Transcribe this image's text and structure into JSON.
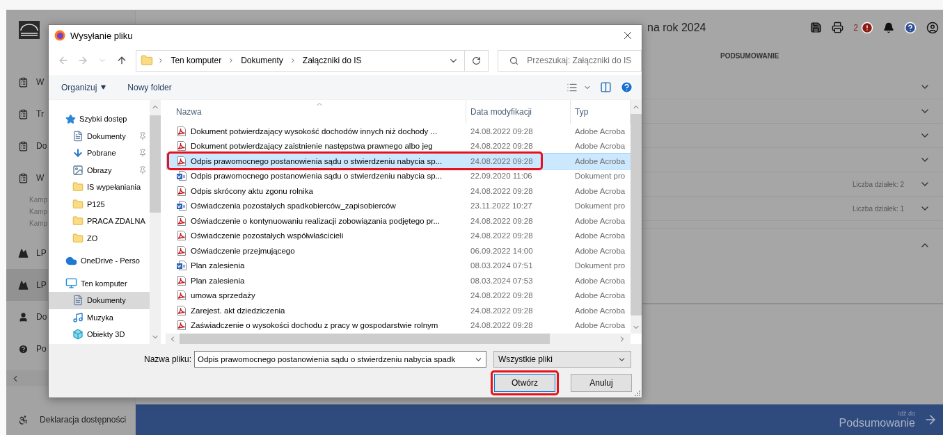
{
  "app": {
    "title": "na rok 2024",
    "alerts": "2",
    "tab": "PODSUMOWANIE",
    "sidebar": [
      {
        "kind": "clipboard",
        "label": "W",
        "selected": false
      },
      {
        "kind": "clipboard",
        "label": "Tr",
        "selected": false
      },
      {
        "kind": "clipboard",
        "label": "Do",
        "selected": false
      },
      {
        "kind": "clipboard",
        "label": "W",
        "selected": false
      },
      {
        "kind": "sub",
        "label": "Kamp",
        "selected": false
      },
      {
        "kind": "sub",
        "label": "Kamp",
        "selected": false
      },
      {
        "kind": "sub",
        "label": "Kamp",
        "selected": false
      },
      {
        "kind": "terrain",
        "label": "LP",
        "selected": false
      },
      {
        "kind": "terrain",
        "label": "LP",
        "selected": true
      },
      {
        "kind": "person",
        "label": "Do",
        "selected": false
      },
      {
        "kind": "help",
        "label": "Po",
        "selected": false
      }
    ],
    "accessibility": "Deklaracja dostępności",
    "sections": [
      {
        "expanded": false
      },
      {
        "expanded": false
      },
      {
        "expanded": false
      },
      {
        "expanded": false
      },
      {
        "expanded": false,
        "count": "Liczba działek: 2"
      },
      {
        "expanded": false,
        "count": "Liczba działek: 1"
      },
      {
        "expanded": true
      }
    ],
    "footer": {
      "caption": "Idź do",
      "target": "Podsumowanie"
    }
  },
  "dialog": {
    "title": "Wysyłanie pliku",
    "path": [
      "Ten komputer",
      "Dokumenty",
      "Załączniki do IS"
    ],
    "search_placeholder": "Przeszukaj: Załączniki do IS",
    "organize": "Organizuj",
    "new_folder": "Nowy folder",
    "nav": [
      {
        "label": "Szybki dostęp",
        "kind": "star",
        "selected": false,
        "children": [
          {
            "label": "Dokumenty",
            "kind": "documents",
            "pinned": true,
            "selected": false
          },
          {
            "label": "Pobrane",
            "kind": "download",
            "pinned": true,
            "selected": false
          },
          {
            "label": "Obrazy",
            "kind": "pictures",
            "pinned": true,
            "selected": false
          },
          {
            "label": "IS wypełaniania",
            "kind": "folder",
            "pinned": false,
            "selected": false
          },
          {
            "label": "P125",
            "kind": "folder",
            "pinned": false,
            "selected": false
          },
          {
            "label": "PRACA ZDALNA",
            "kind": "folder",
            "pinned": false,
            "selected": false
          },
          {
            "label": "ZO",
            "kind": "folder",
            "pinned": false,
            "selected": false
          }
        ]
      },
      {
        "label": "OneDrive - Perso",
        "kind": "cloud",
        "selected": false
      },
      {
        "label": "Ten komputer",
        "kind": "computer",
        "selected": false,
        "children": [
          {
            "label": "Dokumenty",
            "kind": "documents",
            "pinned": false,
            "selected": true
          },
          {
            "label": "Muzyka",
            "kind": "music",
            "pinned": false,
            "selected": false
          },
          {
            "label": "Obiekty 3D",
            "kind": "cube",
            "pinned": false,
            "selected": false
          }
        ]
      }
    ],
    "columns": [
      "Nazwa",
      "Data modyfikacji",
      "Typ"
    ],
    "rows": [
      {
        "kind": "pdf",
        "name": "Dokument potwierdzający wysokość dochodów innych niż dochody ...",
        "date": "24.08.2022 09:28",
        "type": "Adobe Acroba",
        "selected": false,
        "highlighted": false
      },
      {
        "kind": "pdf",
        "name": "Dokument potwierdzający zaistnienie następstwa prawnego albo jeg",
        "date": "24.08.2022 09:28",
        "type": "Adobe Acroba",
        "selected": false,
        "highlighted": false
      },
      {
        "kind": "pdf",
        "name": "Odpis prawomocnego postanowienia sądu o stwierdzeniu nabycia sp...",
        "date": "24.08.2022 09:28",
        "type": "Adobe Acroba",
        "selected": true,
        "highlighted": true
      },
      {
        "kind": "word",
        "name": "Odpis prawomocnego postanowienia sądu o stwierdzeniu nabycia sp...",
        "date": "22.09.2020 11:06",
        "type": "Dokument pro",
        "selected": false,
        "highlighted": false
      },
      {
        "kind": "pdf",
        "name": "Odpis skrócony aktu zgonu rolnika",
        "date": "24.08.2022 09:28",
        "type": "Adobe Acroba",
        "selected": false,
        "highlighted": false
      },
      {
        "kind": "word",
        "name": "Oświadczenia pozostałych spadkobierców_zapisobierców",
        "date": "23.11.2022 10:27",
        "type": "Dokument pro",
        "selected": false,
        "highlighted": false
      },
      {
        "kind": "pdf",
        "name": "Oświadczenie o kontynuowaniu realizacji zobowiązania podjętego pr...",
        "date": "24.08.2022 09:28",
        "type": "Adobe Acroba",
        "selected": false,
        "highlighted": false
      },
      {
        "kind": "pdf",
        "name": "Oświadczenie pozostałych współwłaścicieli",
        "date": "24.08.2022 09:28",
        "type": "Adobe Acroba",
        "selected": false,
        "highlighted": false
      },
      {
        "kind": "pdf",
        "name": "Oświadczenie przejmującego",
        "date": "06.09.2022 14:00",
        "type": "Adobe Acroba",
        "selected": false,
        "highlighted": false
      },
      {
        "kind": "word",
        "name": "Plan zalesienia",
        "date": "08.03.2024 07:51",
        "type": "Dokument pro",
        "selected": false,
        "highlighted": false
      },
      {
        "kind": "pdf",
        "name": "Plan zalesienia",
        "date": "08.03.2024 07:53",
        "type": "Adobe Acroba",
        "selected": false,
        "highlighted": false
      },
      {
        "kind": "pdf",
        "name": "umowa sprzedaży",
        "date": "24.08.2022 09:28",
        "type": "Adobe Acroba",
        "selected": false,
        "highlighted": false
      },
      {
        "kind": "pdf",
        "name": "Zarejest. akt dziedziczenia",
        "date": "24.08.2022 09:28",
        "type": "Adobe Acroba",
        "selected": false,
        "highlighted": false
      },
      {
        "kind": "pdf",
        "name": "Zaświadczenie o wysokości dochodu z pracy w gospodarstwie rolnym",
        "date": "24.08.2022 09:28",
        "type": "Adobe Acroba",
        "selected": false,
        "highlighted": false
      }
    ],
    "filename_label": "Nazwa pliku:",
    "filename": "Odpis prawomocnego postanowienia sądu o stwierdzeniu nabycia spadk",
    "filter": "Wszystkie pliki",
    "buttons": [
      {
        "label": "Otwórz",
        "kind": "default",
        "highlighted": true
      },
      {
        "label": "Anuluj",
        "kind": "normal",
        "highlighted": false
      }
    ]
  }
}
